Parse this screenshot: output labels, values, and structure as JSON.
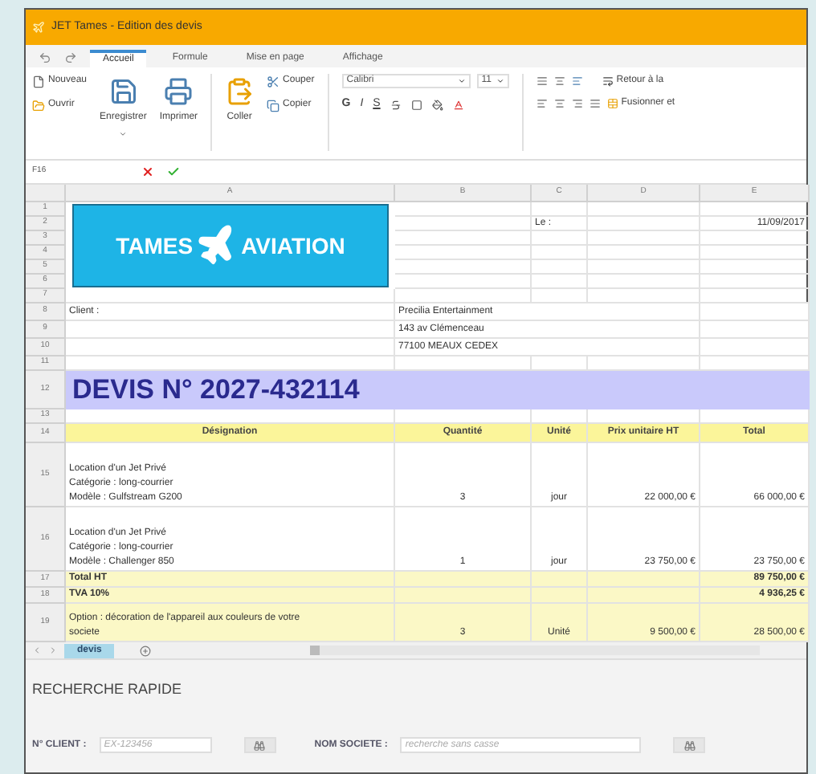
{
  "window": {
    "title": "JET Tames - Edition des devis"
  },
  "tabs": [
    {
      "label": "Accueil",
      "selected": true
    },
    {
      "label": "Formule",
      "selected": false
    },
    {
      "label": "Mise en page",
      "selected": false
    },
    {
      "label": "Affichage",
      "selected": false
    }
  ],
  "ribbon": {
    "file_small": [
      "Nouveau",
      "Ouvrir"
    ],
    "file_large": [
      "Enregistrer",
      "Imprimer"
    ],
    "paste": "Coller",
    "clipboard_small": [
      "Couper",
      "Copier"
    ],
    "font_name": "Calibri",
    "font_size": "11",
    "style_buttons": [
      "G",
      "I",
      "S"
    ],
    "wrap": "Retour à la",
    "merge": "Fusionner et"
  },
  "formula_bar": {
    "cell_ref": "F16"
  },
  "sheet": {
    "columns": [
      "A",
      "B",
      "C",
      "D",
      "E"
    ],
    "logo": {
      "left": "TAMES",
      "right": "AVIATION"
    },
    "top_rows": [
      "1",
      "2",
      "3",
      "4",
      "5",
      "6",
      "7"
    ],
    "date_label": "Le :",
    "date": "11/09/2017",
    "rows": [
      {
        "number": "8",
        "kind": "client",
        "cells": [
          "Client :",
          "Precilia Entertainment",
          "",
          "",
          ""
        ]
      },
      {
        "number": "9",
        "kind": "client",
        "cells": [
          "",
          "143 av Clémenceau",
          "",
          "",
          ""
        ]
      },
      {
        "number": "10",
        "kind": "client",
        "cells": [
          "",
          "77100 MEAUX CEDEX",
          "",
          "",
          ""
        ]
      },
      {
        "number": "11",
        "kind": "blank",
        "cells": [
          "",
          "",
          "",
          "",
          ""
        ]
      },
      {
        "number": "12",
        "kind": "title",
        "cells": [
          "DEVIS N° 2027-432114",
          "",
          "",
          "",
          ""
        ]
      },
      {
        "number": "13",
        "kind": "blank",
        "cells": [
          "",
          "",
          "",
          "",
          ""
        ]
      },
      {
        "number": "14",
        "kind": "header",
        "cells": [
          "Désignation",
          "Quantité",
          "Unité",
          "Prix unitaire HT",
          "Total"
        ]
      },
      {
        "number": "15",
        "kind": "item",
        "cells": [
          "Location d'un Jet Privé\nCatégorie : long-courrier\nModèle : Gulfstream G200",
          "3",
          "jour",
          "22 000,00 €",
          "66 000,00 €"
        ]
      },
      {
        "number": "16",
        "kind": "item",
        "cells": [
          "Location d'un Jet Privé\nCatégorie : long-courrier\nModèle : Challenger 850",
          "1",
          "jour",
          "23 750,00 €",
          "23 750,00 €"
        ]
      },
      {
        "number": "17",
        "kind": "total",
        "cells": [
          "Total HT",
          "",
          "",
          "",
          "89 750,00 €"
        ]
      },
      {
        "number": "18",
        "kind": "total",
        "cells": [
          "TVA 10%",
          "",
          "",
          "",
          "4 936,25 €"
        ]
      },
      {
        "number": "19",
        "kind": "option",
        "cells": [
          "Option : décoration de l'appareil aux couleurs de votre\nsociete",
          "3",
          "Unité",
          "9 500,00 €",
          "28 500,00 €"
        ]
      }
    ]
  },
  "sheet_tabs": [
    {
      "label": "devis",
      "selected": true
    }
  ],
  "search": {
    "title": "RECHERCHE RAPIDE",
    "fields": [
      {
        "label": "N° CLIENT :",
        "placeholder": "EX-123456"
      },
      {
        "label": "NOM SOCIETE :",
        "placeholder": "recherche sans casse"
      }
    ]
  }
}
